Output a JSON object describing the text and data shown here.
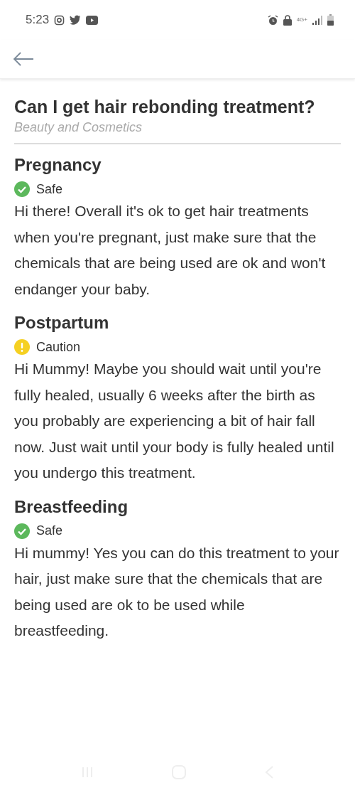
{
  "status_bar": {
    "time": "5:23",
    "network": "4G+"
  },
  "question": {
    "title": "Can I get hair rebonding treatment?",
    "category": "Beauty and Cosmetics"
  },
  "sections": [
    {
      "heading": "Pregnancy",
      "kind": "safe",
      "verdict": "Safe",
      "text": "Hi there! Overall it's ok to get hair treatments when you're pregnant, just make sure that the chemicals that are being used are ok and won't endanger your baby."
    },
    {
      "heading": "Postpartum",
      "kind": "caution",
      "verdict": "Caution",
      "text": "Hi Mummy! Maybe you should wait until you're fully healed, usually 6 weeks after the birth as you probably are experiencing a bit of hair fall now. Just wait until your body is fully healed until you undergo this treatment."
    },
    {
      "heading": "Breastfeeding",
      "kind": "safe",
      "verdict": "Safe",
      "text": "Hi mummy! Yes you can do this treatment to your hair, just make sure that the chemicals that are being used are ok to be used while breastfeeding."
    }
  ]
}
